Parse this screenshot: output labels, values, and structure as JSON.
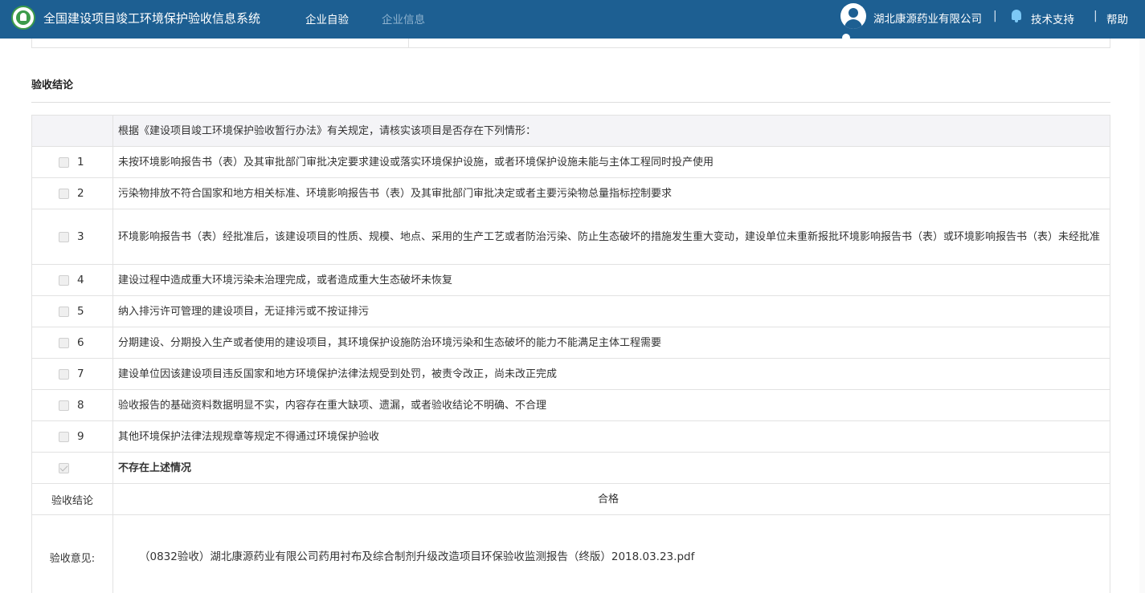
{
  "header": {
    "system_title": "全国建设项目竣工环境保护验收信息系统",
    "nav": [
      "企业自验",
      "企业信息"
    ],
    "company": "湖北康源药业有限公司",
    "separator": "|",
    "support": "技术支持",
    "help": "帮助",
    "bg_color": "#1d5f92"
  },
  "section": {
    "title": "验收结论"
  },
  "table": {
    "intro": "根据《建设项目竣工环境保护验收暂行办法》有关规定，请核实该项目是否存在下列情形：",
    "items": [
      {
        "num": "1",
        "text": "未按环境影响报告书（表）及其审批部门审批决定要求建设或落实环境保护设施，或者环境保护设施未能与主体工程同时投产使用",
        "checked": false
      },
      {
        "num": "2",
        "text": "污染物排放不符合国家和地方相关标准、环境影响报告书（表）及其审批部门审批决定或者主要污染物总量指标控制要求",
        "checked": false
      },
      {
        "num": "3",
        "text": "环境影响报告书（表）经批准后，该建设项目的性质、规模、地点、采用的生产工艺或者防治污染、防止生态破坏的措施发生重大变动，建设单位未重新报批环境影响报告书（表）或环境影响报告书（表）未经批准",
        "checked": false
      },
      {
        "num": "4",
        "text": "建设过程中造成重大环境污染未治理完成，或者造成重大生态破坏未恢复",
        "checked": false
      },
      {
        "num": "5",
        "text": "纳入排污许可管理的建设项目，无证排污或不按证排污",
        "checked": false
      },
      {
        "num": "6",
        "text": "分期建设、分期投入生产或者使用的建设项目，其环境保护设施防治环境污染和生态破坏的能力不能满足主体工程需要",
        "checked": false
      },
      {
        "num": "7",
        "text": "建设单位因该建设项目违反国家和地方环境保护法律法规受到处罚，被责令改正，尚未改正完成",
        "checked": false
      },
      {
        "num": "8",
        "text": "验收报告的基础资料数据明显不实，内容存在重大缺项、遗漏，或者验收结论不明确、不合理",
        "checked": false
      },
      {
        "num": "9",
        "text": "其他环境保护法律法规规章等规定不得通过环境保护验收",
        "checked": false
      }
    ],
    "none_label": "不存在上述情况",
    "none_checked": true,
    "conclusion_label": "验收结论",
    "conclusion_value": "合格",
    "opinion_label": "验收意见:",
    "opinion_value": "（0832验收）湖北康源药业有限公司药用衬布及综合制剂升级改造项目环保验收监测报告（终版）2018.03.23.pdf"
  }
}
